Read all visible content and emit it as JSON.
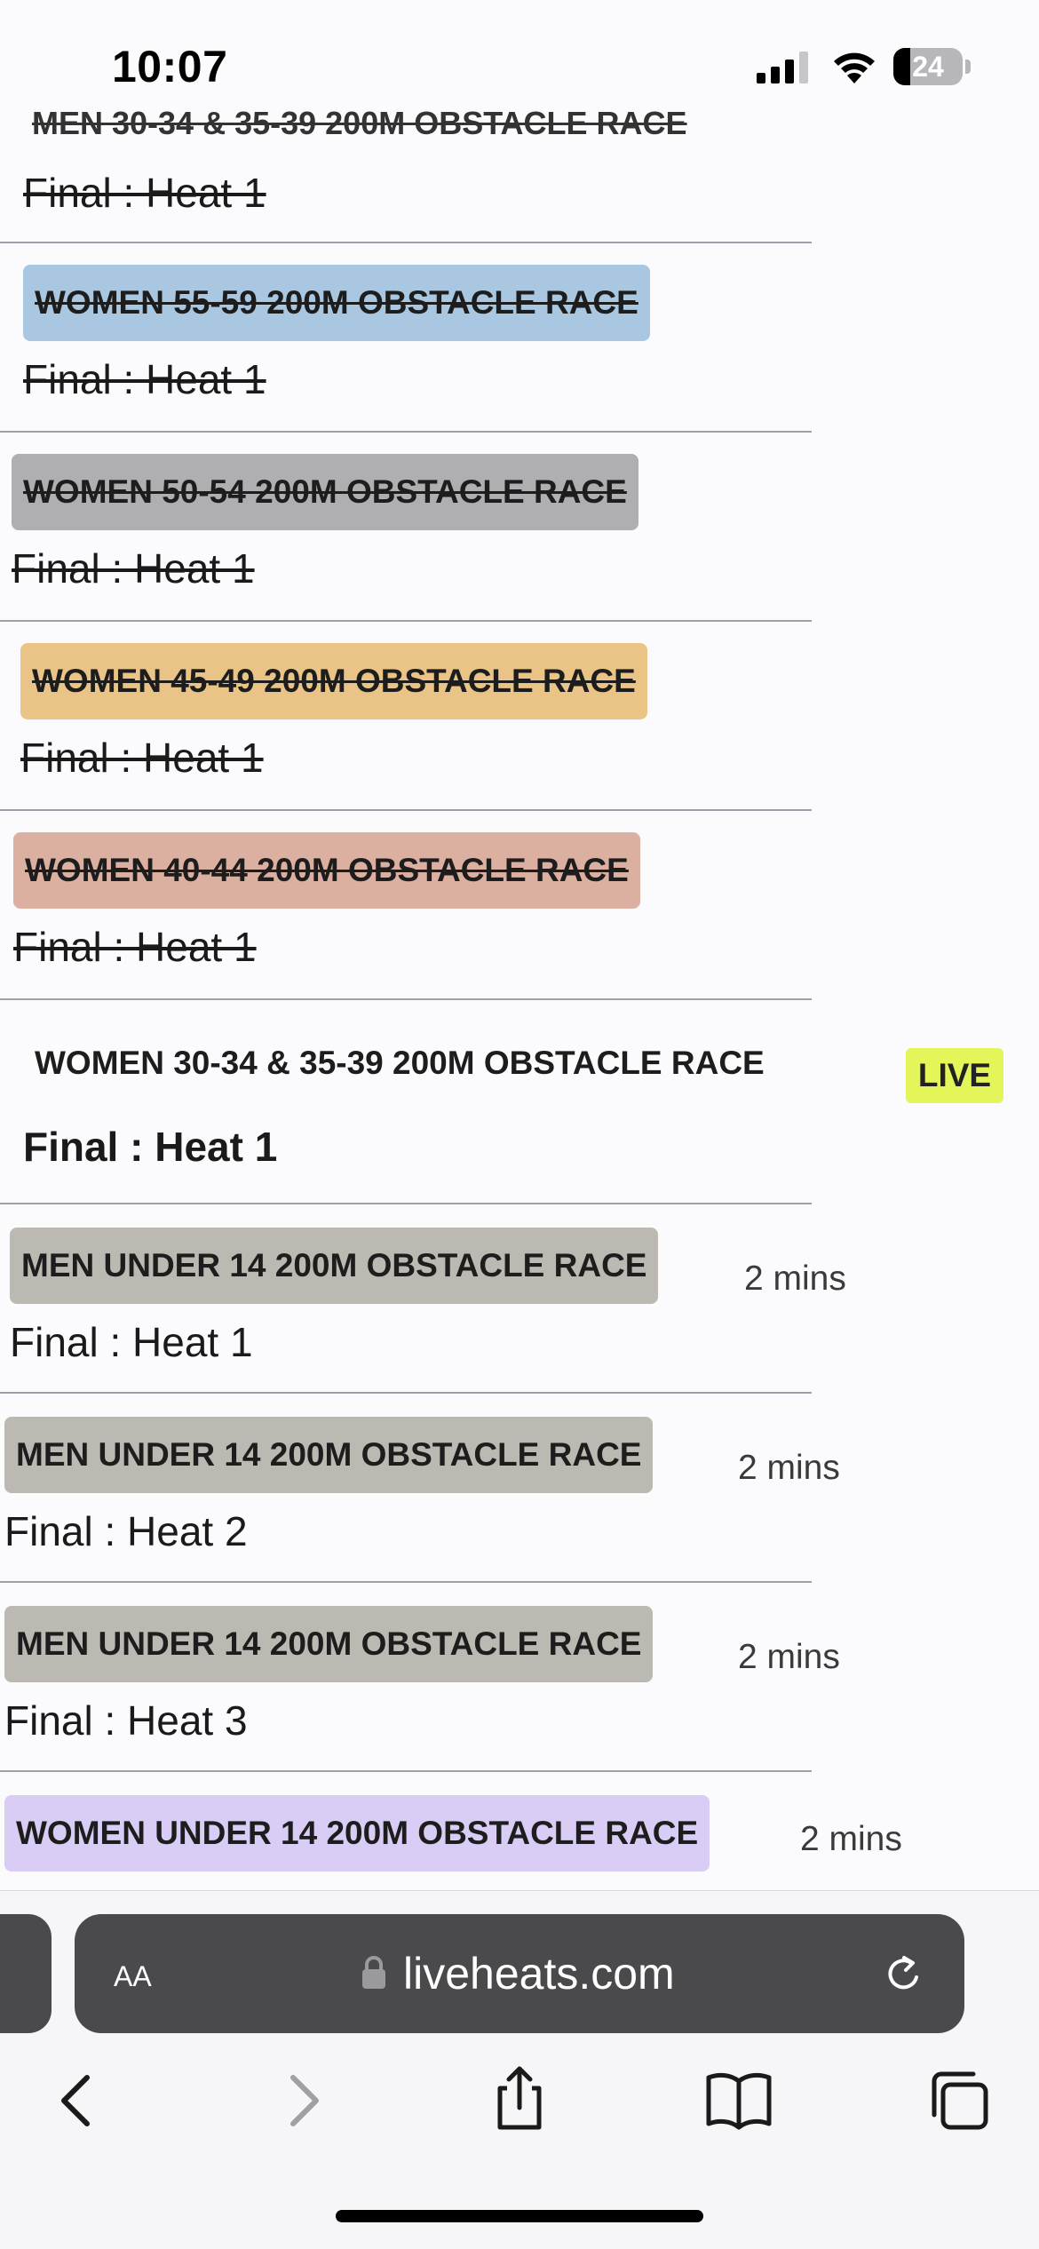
{
  "status_bar": {
    "time": "10:07",
    "battery_level": "24",
    "icons": [
      "signal-icon",
      "wifi-icon",
      "battery-icon"
    ]
  },
  "race_list": {
    "clipped_title": "MEN 30-34 & 35-39 200M OBSTACLE RACE",
    "clipped_heat": "Final : Heat 1",
    "rows": [
      {
        "title": "WOMEN 55-59 200M OBSTACLE RACE",
        "heat": "Final : Heat 1",
        "status": "completed",
        "color": "#a9c7e0"
      },
      {
        "title": "WOMEN 50-54 200M OBSTACLE RACE",
        "heat": "Final : Heat 1",
        "status": "completed",
        "color": "#afaeb1"
      },
      {
        "title": "WOMEN 45-49 200M OBSTACLE RACE",
        "heat": "Final : Heat 1",
        "status": "completed",
        "color": "#e9c486"
      },
      {
        "title": "WOMEN 40-44 200M OBSTACLE RACE",
        "heat": "Final : Heat 1",
        "status": "completed",
        "color": "#dcb0a1"
      },
      {
        "title": "WOMEN 30-34 & 35-39 200M OBSTACLE RACE",
        "heat": "Final : Heat 1",
        "status": "live",
        "live_label": "LIVE",
        "color": "#fbfbfd"
      },
      {
        "title": "MEN UNDER 14 200M OBSTACLE RACE",
        "heat": "Final : Heat 1",
        "status": "upcoming",
        "eta": "2 mins",
        "color": "#bcb9b3"
      },
      {
        "title": "MEN UNDER 14 200M OBSTACLE RACE",
        "heat": "Final : Heat 2",
        "status": "upcoming",
        "eta": "2 mins",
        "color": "#bcb9b3"
      },
      {
        "title": "MEN UNDER 14 200M OBSTACLE RACE",
        "heat": "Final : Heat 3",
        "status": "upcoming",
        "eta": "2 mins",
        "color": "#bcb9b3"
      },
      {
        "title": "WOMEN UNDER 14 200M OBSTACLE RACE",
        "heat": "",
        "status": "upcoming",
        "eta": "2 mins",
        "color": "#d9cdf5"
      }
    ]
  },
  "browser": {
    "text_size_label": "AA",
    "url": "liveheats.com",
    "toolbar_icons": [
      "back-icon",
      "forward-icon",
      "share-icon",
      "bookmarks-icon",
      "tabs-icon"
    ]
  }
}
